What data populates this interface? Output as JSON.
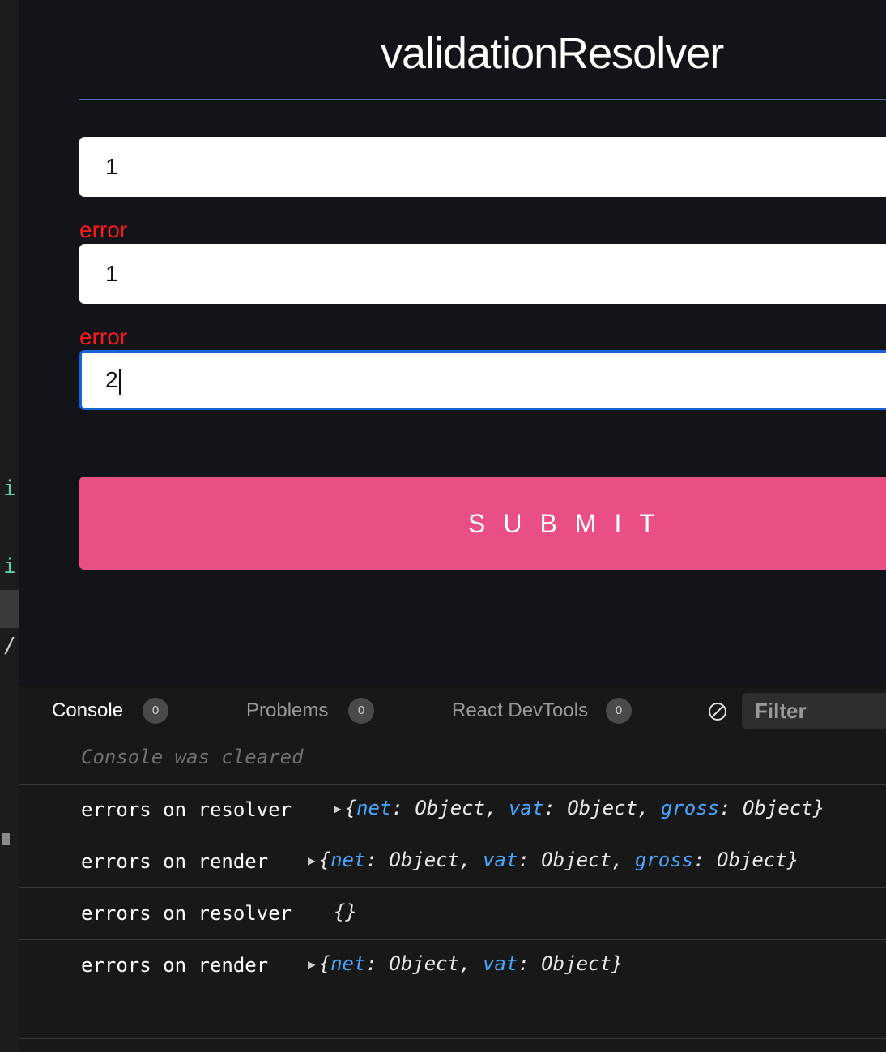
{
  "app": {
    "title": "validationResolver",
    "fields": [
      {
        "value": "1",
        "error": "error"
      },
      {
        "value": "1",
        "error": "error"
      },
      {
        "value": "2"
      }
    ],
    "submit_label": "SUBMIT"
  },
  "editor_gutter": {
    "glyphs": [
      "i",
      "i",
      "/"
    ]
  },
  "devtools": {
    "tabs": [
      {
        "label": "Console",
        "count": "0",
        "active": true
      },
      {
        "label": "Problems",
        "count": "0"
      },
      {
        "label": "React DevTools",
        "count": "0"
      }
    ],
    "filter_placeholder": "Filter",
    "cleared_message": "Console was cleared",
    "logs": [
      {
        "message": "errors on resolver",
        "object_open": "{",
        "entries": [
          [
            "net",
            "Object"
          ],
          [
            "vat",
            "Object"
          ],
          [
            "gross",
            "Object"
          ]
        ],
        "object_close": "}"
      },
      {
        "message": "errors on render",
        "object_open": "{",
        "entries": [
          [
            "net",
            "Object"
          ],
          [
            "vat",
            "Object"
          ],
          [
            "gross",
            "Object"
          ]
        ],
        "object_close": "}"
      },
      {
        "message": "errors on resolver",
        "object_text": "{}"
      },
      {
        "message": "errors on render",
        "object_open": "{",
        "entries": [
          [
            "net",
            "Object"
          ],
          [
            "vat",
            "Object"
          ]
        ],
        "object_close": "}"
      }
    ]
  },
  "colors": {
    "background": "#131419",
    "submit": "#e94f84",
    "error": "#ff1a1a",
    "focus": "#1764d6",
    "object_key": "#4aa6ff"
  }
}
